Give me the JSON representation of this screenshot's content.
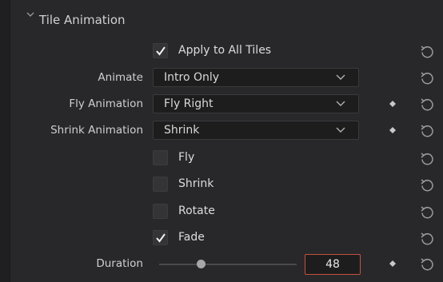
{
  "section": {
    "title": "Tile Animation"
  },
  "apply_all": {
    "label": "Apply to All Tiles",
    "checked": true
  },
  "animate": {
    "label": "Animate",
    "value": "Intro Only"
  },
  "fly_animation": {
    "label": "Fly Animation",
    "value": "Fly Right"
  },
  "shrink_animation": {
    "label": "Shrink Animation",
    "value": "Shrink"
  },
  "options": [
    {
      "label": "Fly",
      "checked": false
    },
    {
      "label": "Shrink",
      "checked": false
    },
    {
      "label": "Rotate",
      "checked": false
    },
    {
      "label": "Fade",
      "checked": true
    }
  ],
  "duration": {
    "label": "Duration",
    "value": "48"
  },
  "colors": {
    "accent_border": "#c4523f"
  },
  "icons": {
    "reset": "reset-icon",
    "keyframe": "keyframe-diamond-icon",
    "dropdown": "chevron-down-icon",
    "collapse": "chevron-down-icon"
  }
}
